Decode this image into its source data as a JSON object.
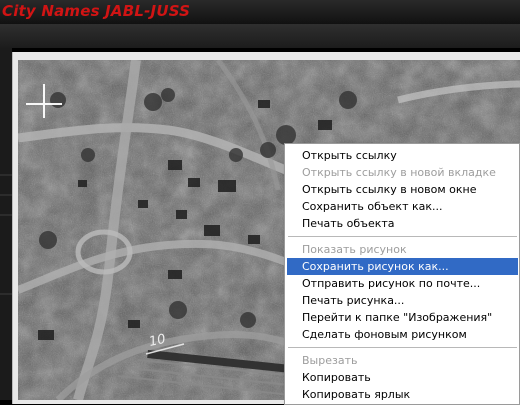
{
  "header": {
    "title": "City Names JABL-JUSS"
  },
  "context_menu": {
    "groups": [
      [
        {
          "label": "Открыть ссылку",
          "enabled": true
        },
        {
          "label": "Открыть ссылку в новой вкладке",
          "enabled": false
        },
        {
          "label": "Открыть ссылку в новом окне",
          "enabled": true
        },
        {
          "label": "Сохранить объект как...",
          "enabled": true
        },
        {
          "label": "Печать объекта",
          "enabled": true
        }
      ],
      [
        {
          "label": "Показать рисунок",
          "enabled": false
        },
        {
          "label": "Сохранить рисунок как...",
          "enabled": true,
          "selected": true
        },
        {
          "label": "Отправить рисунок по почте...",
          "enabled": true
        },
        {
          "label": "Печать рисунка...",
          "enabled": true
        },
        {
          "label": "Перейти к папке \"Изображения\"",
          "enabled": true
        },
        {
          "label": "Сделать фоновым рисунком",
          "enabled": true
        }
      ],
      [
        {
          "label": "Вырезать",
          "enabled": false
        },
        {
          "label": "Копировать",
          "enabled": true
        },
        {
          "label": "Копировать ярлык",
          "enabled": true
        }
      ]
    ]
  },
  "photo": {
    "marker_label": "10"
  },
  "colors": {
    "title_red": "#d11414",
    "menu_highlight": "#316ac5",
    "disabled_text": "#9d9d9d"
  },
  "icons": {
    "crosshair": "crosshair-icon"
  }
}
